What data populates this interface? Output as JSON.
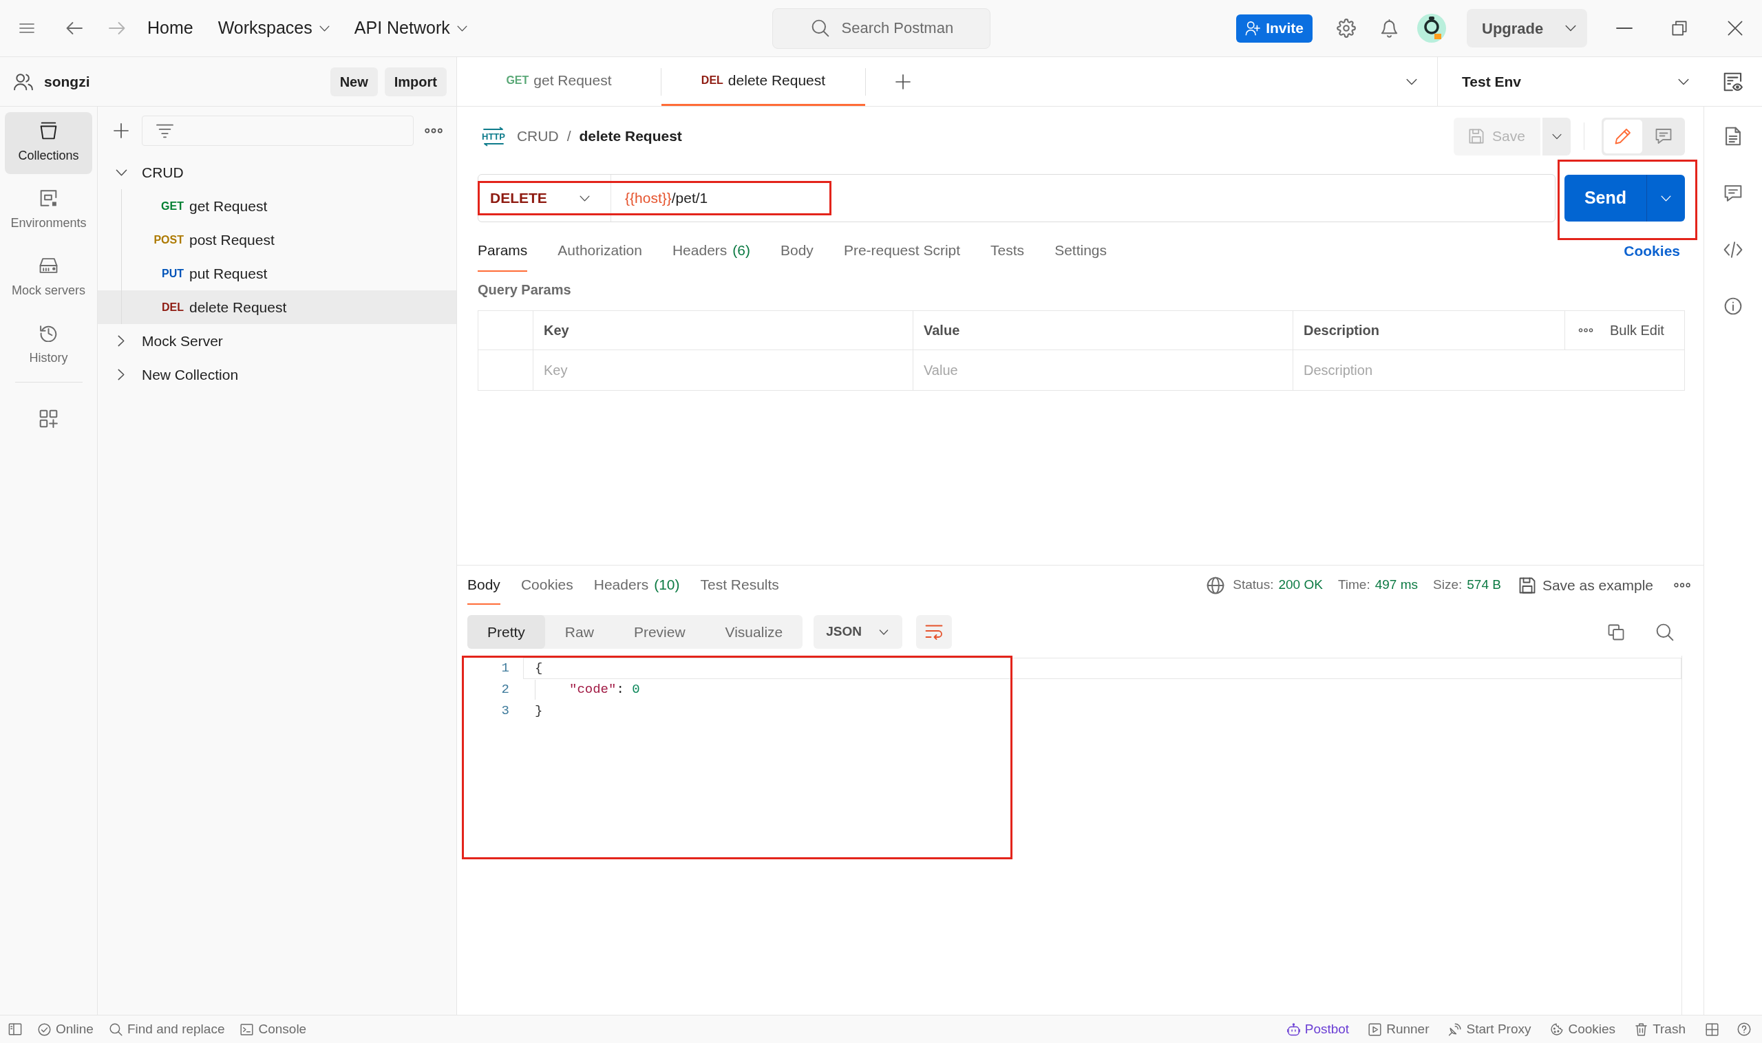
{
  "top_bar": {
    "nav": [
      {
        "label": "Home",
        "dropdown": false
      },
      {
        "label": "Workspaces",
        "dropdown": true
      },
      {
        "label": "API Network",
        "dropdown": true
      }
    ],
    "search": {
      "placeholder": "Search Postman"
    },
    "invite": {
      "label": "Invite"
    },
    "upgrade": {
      "label": "Upgrade"
    }
  },
  "workspace": {
    "name": "songzi",
    "buttons": [
      "New",
      "Import"
    ]
  },
  "tabs": [
    {
      "method": "GET",
      "color": "#5aa877",
      "name": "get Request",
      "selected": false
    },
    {
      "method": "DEL",
      "color": "#8e1a10",
      "name": "delete Request",
      "selected": true
    }
  ],
  "environment": {
    "name": "Test Env"
  },
  "sidebar": {
    "items": [
      {
        "label": "Collections",
        "kind": "collections",
        "selected": true
      },
      {
        "label": "Environments",
        "kind": "environments",
        "selected": false
      },
      {
        "label": "Mock servers",
        "kind": "mock_servers",
        "selected": false
      },
      {
        "label": "History",
        "kind": "history",
        "selected": false
      }
    ]
  },
  "collections": [
    {
      "name": "CRUD",
      "expanded": true,
      "children": [
        {
          "method": "GET",
          "color": "#007f31",
          "name": "get Request",
          "selected": false
        },
        {
          "method": "POST",
          "color": "#ad7a03",
          "name": "post Request",
          "selected": false
        },
        {
          "method": "PUT",
          "color": "#0053b8",
          "name": "put Request",
          "selected": false
        },
        {
          "method": "DEL",
          "color": "#8e1a10",
          "name": "delete Request",
          "selected": true
        }
      ]
    },
    {
      "name": "Mock Server",
      "expanded": false
    },
    {
      "name": "New Collection",
      "expanded": false
    }
  ],
  "breadcrumb": {
    "icon_text": "HTTP",
    "parent": "CRUD",
    "separator": "/",
    "current": "delete Request"
  },
  "save": {
    "label": "Save",
    "disabled": true
  },
  "mode_toggle": [
    {
      "kind": "edit",
      "selected": true
    },
    {
      "kind": "comments",
      "selected": false
    }
  ],
  "request": {
    "method": "DELETE",
    "url": [
      {
        "text": "{{host}}",
        "kind": "variable"
      },
      {
        "text": "/pet/1",
        "kind": "path"
      }
    ],
    "highlighted": true
  },
  "send": {
    "label": "Send",
    "highlighted": true
  },
  "request_tabs": [
    {
      "label": "Params",
      "selected": true
    },
    {
      "label": "Authorization",
      "selected": false
    },
    {
      "label": "Headers",
      "count": "(6)",
      "selected": false
    },
    {
      "label": "Body",
      "selected": false
    },
    {
      "label": "Pre-request Script",
      "selected": false
    },
    {
      "label": "Tests",
      "selected": false
    },
    {
      "label": "Settings",
      "selected": false
    }
  ],
  "cookies_link": "Cookies",
  "query_params": {
    "title": "Query Params",
    "columns": [
      "Key",
      "Value",
      "Description"
    ],
    "bulk_edit": "Bulk Edit",
    "placeholders": [
      "Key",
      "Value",
      "Description"
    ]
  },
  "response": {
    "tabs": [
      {
        "label": "Body",
        "selected": true
      },
      {
        "label": "Cookies",
        "selected": false
      },
      {
        "label": "Headers",
        "count": "(10)",
        "selected": false
      },
      {
        "label": "Test Results",
        "selected": false
      }
    ],
    "meta": [
      {
        "label": "Status:",
        "value": "200 OK"
      },
      {
        "label": "Time:",
        "value": "497 ms"
      },
      {
        "label": "Size:",
        "value": "574 B"
      }
    ],
    "save_example": "Save as example",
    "views": [
      {
        "label": "Pretty",
        "selected": true
      },
      {
        "label": "Raw",
        "selected": false
      },
      {
        "label": "Preview",
        "selected": false
      },
      {
        "label": "Visualize",
        "selected": false
      }
    ],
    "format": "JSON",
    "wrap_on": true,
    "editor": {
      "highlighted": true,
      "lines": [
        {
          "number": "1",
          "active": true,
          "tokens": [
            {
              "text": "{",
              "kind": "brace"
            }
          ],
          "children": [
            {
              "number": "2",
              "active": false,
              "tokens": [
                {
                  "text": "\"code\"",
                  "kind": "key"
                },
                {
                  "text": ":",
                  "kind": "punct"
                },
                {
                  "text": "0",
                  "kind": "number"
                }
              ]
            }
          ]
        },
        {
          "number": "3",
          "active": false,
          "tokens": [
            {
              "text": "}",
              "kind": "brace"
            }
          ]
        }
      ]
    }
  },
  "status_bar": {
    "left": [
      {
        "kind": "online",
        "label": "Online"
      },
      {
        "kind": "find",
        "label": "Find and replace"
      },
      {
        "kind": "console",
        "label": "Console"
      }
    ],
    "right": [
      {
        "kind": "postbot",
        "label": "Postbot"
      },
      {
        "kind": "runner",
        "label": "Runner"
      },
      {
        "kind": "proxy",
        "label": "Start Proxy"
      },
      {
        "kind": "cookies",
        "label": "Cookies"
      },
      {
        "kind": "trash",
        "label": "Trash"
      }
    ]
  }
}
